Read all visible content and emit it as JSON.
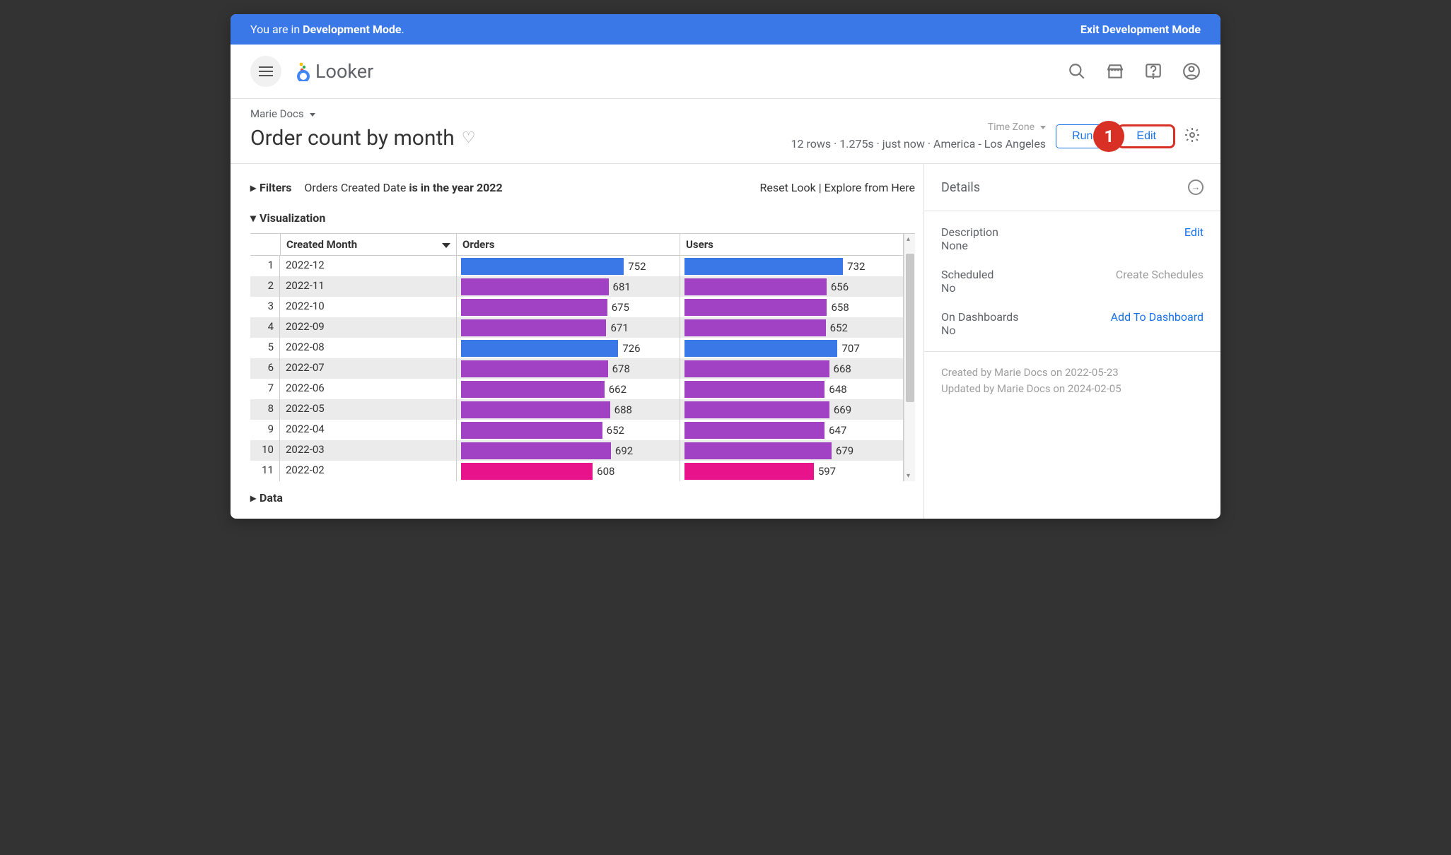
{
  "dev_banner": {
    "prefix": "You are in ",
    "mode": "Development Mode",
    "suffix": ".",
    "exit_label": "Exit Development Mode"
  },
  "brand": {
    "name": "Looker"
  },
  "breadcrumb": {
    "space": "Marie Docs"
  },
  "page": {
    "title": "Order count by month",
    "timezone_label": "Time Zone",
    "stats": "12 rows · 1.275s · just now · America - Los Angeles",
    "run_label": "Run",
    "edit_label": "Edit",
    "callout_number": "1"
  },
  "filters": {
    "label": "Filters",
    "text_prefix": "Orders Created Date ",
    "text_bold": "is in the year 2022",
    "reset_label": "Reset Look",
    "explore_label": "Explore from Here",
    "separator": "  |  "
  },
  "viz": {
    "label": "Visualization",
    "headers": {
      "month": "Created Month",
      "orders": "Orders",
      "users": "Users"
    }
  },
  "data_section": {
    "label": "Data"
  },
  "details": {
    "title": "Details",
    "description_label": "Description",
    "description_value": "None",
    "description_edit": "Edit",
    "scheduled_label": "Scheduled",
    "scheduled_value": "No",
    "scheduled_link": "Create Schedules",
    "dashboards_label": "On Dashboards",
    "dashboards_value": "No",
    "dashboards_link": "Add To Dashboard",
    "created": "Created by Marie Docs on 2022-05-23",
    "updated": "Updated by Marie Docs on 2024-02-05"
  },
  "colors": {
    "blue": "#3b78e7",
    "purple": "#a142c4",
    "magenta": "#e8128b"
  },
  "chart_data": {
    "type": "bar",
    "orientation": "horizontal",
    "categories": [
      "2022-12",
      "2022-11",
      "2022-10",
      "2022-09",
      "2022-08",
      "2022-07",
      "2022-06",
      "2022-05",
      "2022-04",
      "2022-03",
      "2022-02"
    ],
    "series": [
      {
        "name": "Orders",
        "values": [
          752,
          681,
          675,
          671,
          726,
          678,
          662,
          688,
          652,
          692,
          608
        ],
        "colors": [
          "blue",
          "purple",
          "purple",
          "purple",
          "blue",
          "purple",
          "purple",
          "purple",
          "purple",
          "purple",
          "magenta"
        ]
      },
      {
        "name": "Users",
        "values": [
          732,
          656,
          658,
          652,
          707,
          668,
          648,
          669,
          647,
          679,
          597
        ],
        "colors": [
          "blue",
          "purple",
          "purple",
          "purple",
          "blue",
          "purple",
          "purple",
          "purple",
          "purple",
          "purple",
          "magenta"
        ]
      }
    ],
    "xlabel": "",
    "ylabel": "",
    "max_value": 752
  }
}
